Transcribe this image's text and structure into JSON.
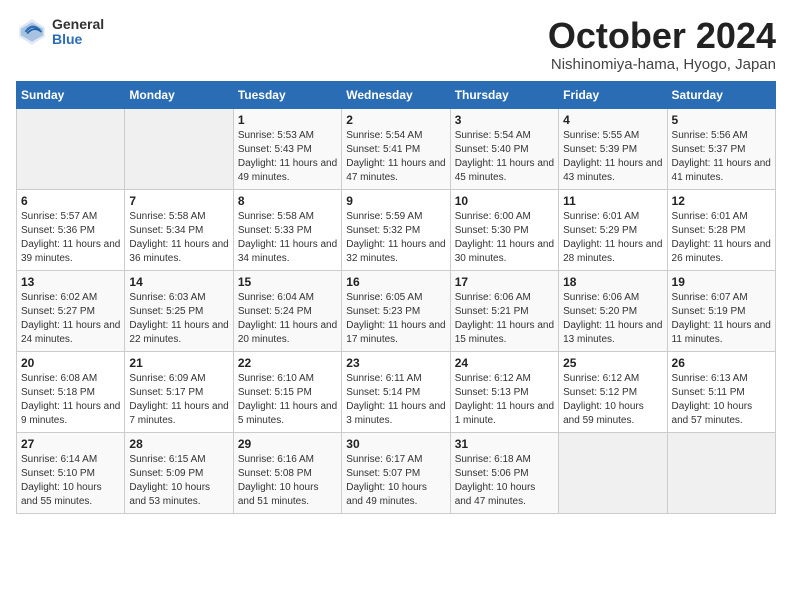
{
  "logo": {
    "general": "General",
    "blue": "Blue"
  },
  "title": "October 2024",
  "subtitle": "Nishinomiya-hama, Hyogo, Japan",
  "header_days": [
    "Sunday",
    "Monday",
    "Tuesday",
    "Wednesday",
    "Thursday",
    "Friday",
    "Saturday"
  ],
  "weeks": [
    [
      {
        "day": "",
        "info": ""
      },
      {
        "day": "",
        "info": ""
      },
      {
        "day": "1",
        "info": "Sunrise: 5:53 AM\nSunset: 5:43 PM\nDaylight: 11 hours and 49 minutes."
      },
      {
        "day": "2",
        "info": "Sunrise: 5:54 AM\nSunset: 5:41 PM\nDaylight: 11 hours and 47 minutes."
      },
      {
        "day": "3",
        "info": "Sunrise: 5:54 AM\nSunset: 5:40 PM\nDaylight: 11 hours and 45 minutes."
      },
      {
        "day": "4",
        "info": "Sunrise: 5:55 AM\nSunset: 5:39 PM\nDaylight: 11 hours and 43 minutes."
      },
      {
        "day": "5",
        "info": "Sunrise: 5:56 AM\nSunset: 5:37 PM\nDaylight: 11 hours and 41 minutes."
      }
    ],
    [
      {
        "day": "6",
        "info": "Sunrise: 5:57 AM\nSunset: 5:36 PM\nDaylight: 11 hours and 39 minutes."
      },
      {
        "day": "7",
        "info": "Sunrise: 5:58 AM\nSunset: 5:34 PM\nDaylight: 11 hours and 36 minutes."
      },
      {
        "day": "8",
        "info": "Sunrise: 5:58 AM\nSunset: 5:33 PM\nDaylight: 11 hours and 34 minutes."
      },
      {
        "day": "9",
        "info": "Sunrise: 5:59 AM\nSunset: 5:32 PM\nDaylight: 11 hours and 32 minutes."
      },
      {
        "day": "10",
        "info": "Sunrise: 6:00 AM\nSunset: 5:30 PM\nDaylight: 11 hours and 30 minutes."
      },
      {
        "day": "11",
        "info": "Sunrise: 6:01 AM\nSunset: 5:29 PM\nDaylight: 11 hours and 28 minutes."
      },
      {
        "day": "12",
        "info": "Sunrise: 6:01 AM\nSunset: 5:28 PM\nDaylight: 11 hours and 26 minutes."
      }
    ],
    [
      {
        "day": "13",
        "info": "Sunrise: 6:02 AM\nSunset: 5:27 PM\nDaylight: 11 hours and 24 minutes."
      },
      {
        "day": "14",
        "info": "Sunrise: 6:03 AM\nSunset: 5:25 PM\nDaylight: 11 hours and 22 minutes."
      },
      {
        "day": "15",
        "info": "Sunrise: 6:04 AM\nSunset: 5:24 PM\nDaylight: 11 hours and 20 minutes."
      },
      {
        "day": "16",
        "info": "Sunrise: 6:05 AM\nSunset: 5:23 PM\nDaylight: 11 hours and 17 minutes."
      },
      {
        "day": "17",
        "info": "Sunrise: 6:06 AM\nSunset: 5:21 PM\nDaylight: 11 hours and 15 minutes."
      },
      {
        "day": "18",
        "info": "Sunrise: 6:06 AM\nSunset: 5:20 PM\nDaylight: 11 hours and 13 minutes."
      },
      {
        "day": "19",
        "info": "Sunrise: 6:07 AM\nSunset: 5:19 PM\nDaylight: 11 hours and 11 minutes."
      }
    ],
    [
      {
        "day": "20",
        "info": "Sunrise: 6:08 AM\nSunset: 5:18 PM\nDaylight: 11 hours and 9 minutes."
      },
      {
        "day": "21",
        "info": "Sunrise: 6:09 AM\nSunset: 5:17 PM\nDaylight: 11 hours and 7 minutes."
      },
      {
        "day": "22",
        "info": "Sunrise: 6:10 AM\nSunset: 5:15 PM\nDaylight: 11 hours and 5 minutes."
      },
      {
        "day": "23",
        "info": "Sunrise: 6:11 AM\nSunset: 5:14 PM\nDaylight: 11 hours and 3 minutes."
      },
      {
        "day": "24",
        "info": "Sunrise: 6:12 AM\nSunset: 5:13 PM\nDaylight: 11 hours and 1 minute."
      },
      {
        "day": "25",
        "info": "Sunrise: 6:12 AM\nSunset: 5:12 PM\nDaylight: 10 hours and 59 minutes."
      },
      {
        "day": "26",
        "info": "Sunrise: 6:13 AM\nSunset: 5:11 PM\nDaylight: 10 hours and 57 minutes."
      }
    ],
    [
      {
        "day": "27",
        "info": "Sunrise: 6:14 AM\nSunset: 5:10 PM\nDaylight: 10 hours and 55 minutes."
      },
      {
        "day": "28",
        "info": "Sunrise: 6:15 AM\nSunset: 5:09 PM\nDaylight: 10 hours and 53 minutes."
      },
      {
        "day": "29",
        "info": "Sunrise: 6:16 AM\nSunset: 5:08 PM\nDaylight: 10 hours and 51 minutes."
      },
      {
        "day": "30",
        "info": "Sunrise: 6:17 AM\nSunset: 5:07 PM\nDaylight: 10 hours and 49 minutes."
      },
      {
        "day": "31",
        "info": "Sunrise: 6:18 AM\nSunset: 5:06 PM\nDaylight: 10 hours and 47 minutes."
      },
      {
        "day": "",
        "info": ""
      },
      {
        "day": "",
        "info": ""
      }
    ]
  ]
}
